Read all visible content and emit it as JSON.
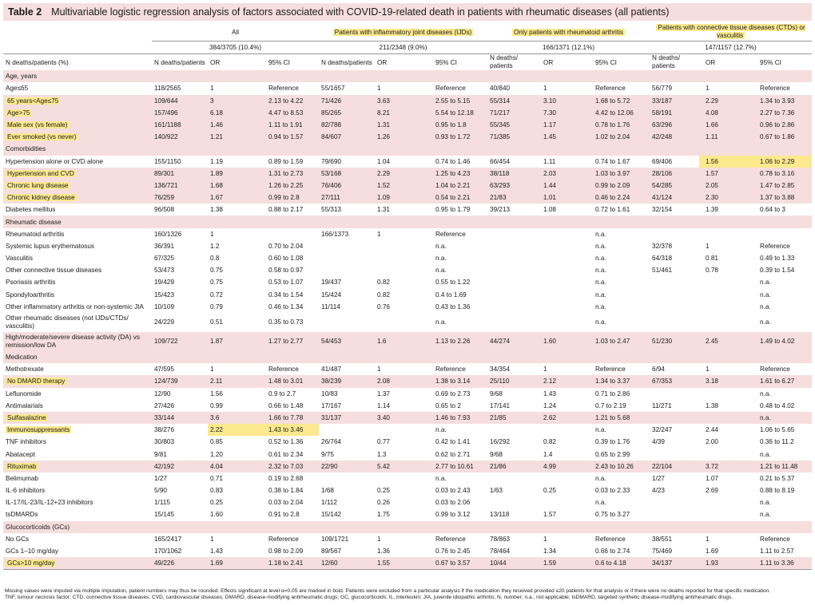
{
  "title": {
    "label": "Table 2",
    "text": "Multivariable logistic regression analysis of factors associated with COVID-19-related death in patients with rheumatic diseases (all patients)"
  },
  "groups": [
    {
      "name": "All",
      "total": "384/3705 (10.4%)",
      "highlight": false
    },
    {
      "name": "Patients with inflammatory joint diseases (IJDs)",
      "total": "211/2348 (9.0%)",
      "highlight": true
    },
    {
      "name": "Only patients with rheumatoid arthritis",
      "total": "166/1371 (12.1%)",
      "highlight": true
    },
    {
      "name": "Patients with connective tissue diseases (CTDs) or vasculitis",
      "total": "147/1157 (12.7%)",
      "highlight": true
    }
  ],
  "column_headers": {
    "first": "N deaths/patients (%)",
    "g1": [
      "N deaths/patients",
      "OR",
      "95% CI"
    ],
    "g2": [
      "N deaths/patients",
      "OR",
      "95% CI"
    ],
    "g3": [
      "N deaths/ patients",
      "OR",
      "95% CI"
    ],
    "g4": [
      "N deaths/ patients",
      "OR",
      "95% CI"
    ]
  },
  "rows": [
    {
      "type": "section",
      "label": "Age, years"
    },
    {
      "label": "Age≤65",
      "indent": true,
      "cells": [
        "118/2565",
        "1",
        "Reference",
        "55/1657",
        "1",
        "Reference",
        "40/840",
        "1",
        "Reference",
        "56/779",
        "1",
        "Reference"
      ]
    },
    {
      "label": "65 years<Age≤75",
      "indent": true,
      "pink": true,
      "hl_label": true,
      "bold": [
        1,
        2,
        4,
        5,
        7,
        8,
        10,
        11
      ],
      "hl": [
        1,
        2,
        4,
        5,
        7,
        8,
        10,
        11
      ],
      "cells": [
        "109/644",
        "3",
        "2.13 to 4.22",
        "71/426",
        "3.63",
        "2.55 to 5.15",
        "55/314",
        "3.10",
        "1.68 to 5.72",
        "33/187",
        "2.29",
        "1.34 to 3.93"
      ]
    },
    {
      "label": "Age>75",
      "indent": true,
      "pink": true,
      "hl_label": true,
      "bold": [
        1,
        2,
        4,
        5,
        7,
        8,
        10,
        11
      ],
      "hl": [
        1,
        2,
        4,
        5,
        7,
        8,
        10,
        11
      ],
      "cells": [
        "157/496",
        "6.18",
        "4.47 to 8.53",
        "85/265",
        "8.21",
        "5.54 to 12.18",
        "71/217",
        "7.30",
        "4.42 to 12.06",
        "58/191",
        "4.08",
        "2.27 to 7.36"
      ]
    },
    {
      "label": "Male sex (vs female)",
      "indent": false,
      "pink": true,
      "hl_label": true,
      "bold": [
        1,
        2
      ],
      "hl": [
        1,
        2
      ],
      "cells": [
        "161/1188",
        "1.46",
        "1.11 to 1.91",
        "82/788",
        "1.31",
        "0.95 to 1.8",
        "55/345",
        "1.17",
        "0.78 to 1.76",
        "63/296",
        "1.66",
        "0.96 to 2.86"
      ]
    },
    {
      "label": "Ever smoked (vs never)",
      "indent": false,
      "pink": true,
      "hl_label": true,
      "bold": [
        7,
        8
      ],
      "hl": [
        7,
        8
      ],
      "cells": [
        "140/922",
        "1.21",
        "0.94 to 1.57",
        "84/607",
        "1.26",
        "0.93 to 1.72",
        "71/385",
        "1.45",
        "1.02 to 2.04",
        "42/248",
        "1.11",
        "0.67 to 1.86"
      ]
    },
    {
      "type": "section",
      "label": "Comorbidities"
    },
    {
      "label": "Hypertension alone or CVD alone",
      "indent": true,
      "bold": [
        10,
        11
      ],
      "hl": [
        10,
        11
      ],
      "cells": [
        "155/1150",
        "1.19",
        "0.89 to 1.59",
        "79/690",
        "1.04",
        "0.74 to 1.46",
        "66/454",
        "1.11",
        "0.74 to 1.67",
        "69/406",
        "1.56",
        "1.06 to 2.29"
      ]
    },
    {
      "label": "Hypertension and CVD",
      "indent": true,
      "pink": true,
      "hl_label": true,
      "bold": [
        1,
        2,
        4,
        5,
        7,
        8
      ],
      "hl": [
        1,
        2,
        4,
        5,
        7,
        8
      ],
      "cells": [
        "89/301",
        "1.89",
        "1.31 to 2.73",
        "53/168",
        "2.29",
        "1.25 to 4.23",
        "38/118",
        "2.03",
        "1.03 to 3.97",
        "28/106",
        "1.57",
        "0.78 to 3.16"
      ]
    },
    {
      "label": "Chronic lung disease",
      "indent": true,
      "pink": true,
      "hl_label": true,
      "bold": [
        1,
        2,
        4,
        5,
        10,
        11
      ],
      "hl": [
        1,
        2,
        4,
        5,
        10,
        11
      ],
      "cells": [
        "136/721",
        "1.68",
        "1.26 to 2.25",
        "76/406",
        "1.52",
        "1.04 to 2.21",
        "63/293",
        "1.44",
        "0.99 to 2.09",
        "54/285",
        "2.05",
        "1.47 to 2.85"
      ]
    },
    {
      "label": "Chronic kidney disease",
      "indent": true,
      "pink": true,
      "hl_label": true,
      "bold": [
        10,
        11
      ],
      "hl": [
        10,
        11
      ],
      "cells": [
        "76/259",
        "1.67",
        "0.99 to 2.8",
        "27/111",
        "1.09",
        "0.54 to 2.21",
        "21/83",
        "1.01",
        "0.46 to 2.24",
        "41/124",
        "2.30",
        "1.37 to 3.88"
      ]
    },
    {
      "label": "Diabetes mellitus",
      "indent": true,
      "cells": [
        "96/508",
        "1.38",
        "0.88 to 2.17",
        "55/313",
        "1.31",
        "0.95 to 1.79",
        "39/213",
        "1.08",
        "0.72 to 1.61",
        "32/154",
        "1.39",
        "0.64 to 3"
      ]
    },
    {
      "type": "section",
      "label": "Rheumatic disease"
    },
    {
      "label": "Rheumatoid arthritis",
      "indent": true,
      "cells": [
        "160/1326",
        "1",
        "",
        "166/1373",
        "1",
        "Reference",
        "",
        "",
        "n.a.",
        "",
        "",
        ""
      ]
    },
    {
      "label": "Systemic lupus erythematosus",
      "indent": true,
      "cells": [
        "36/391",
        "1.2",
        "0.70 to 2.04",
        "",
        "",
        "n.a.",
        "",
        "",
        "n.a.",
        "32/378",
        "1",
        "Reference"
      ]
    },
    {
      "label": "Vasculitis",
      "indent": true,
      "cells": [
        "67/325",
        "0.8",
        "0.60 to 1.08",
        "",
        "",
        "n.a.",
        "",
        "",
        "n.a.",
        "64/318",
        "0.81",
        "0.49 to 1.33"
      ]
    },
    {
      "label": "Other connective tissue diseases",
      "indent": true,
      "bold": [
        1,
        2
      ],
      "cells": [
        "53/473",
        "0.75",
        "0.58 to 0.97",
        "",
        "",
        "n.a.",
        "",
        "",
        "n.a.",
        "51/461",
        "0.78",
        "0.39 to 1.54"
      ]
    },
    {
      "label": "Psoriasis arthritis",
      "indent": true,
      "cells": [
        "19/429",
        "0.75",
        "0.53 to 1.07",
        "19/437",
        "0.82",
        "0.55 to 1.22",
        "",
        "",
        "n.a.",
        "",
        "",
        "n.a."
      ]
    },
    {
      "label": "Spondyloarthritis",
      "indent": true,
      "cells": [
        "15/423",
        "0.72",
        "0.34 to 1.54",
        "15/424",
        "0.82",
        "0.4 to 1.69",
        "",
        "",
        "n.a.",
        "",
        "",
        "n.a."
      ]
    },
    {
      "label": "Other inflammatory arthritis or non-systemic JIA",
      "indent": true,
      "cells": [
        "10/109",
        "0.79",
        "0.46 to 1.34",
        "11/114",
        "0.76",
        "0.43 to 1.36",
        "",
        "",
        "n.a.",
        "",
        "",
        "n.a."
      ]
    },
    {
      "label": "Other rheumatic diseases (not IJDs/CTDs/ vasculitis)",
      "indent": true,
      "tall": true,
      "bold": [
        1,
        2
      ],
      "cells": [
        "24/229",
        "0.51",
        "0.35 to 0.73",
        "",
        "",
        "n.a.",
        "",
        "",
        "n.a.",
        "",
        "",
        "n.a."
      ]
    },
    {
      "label": "High/moderate/severe disease activity (DA) vs remission/low DA",
      "indent": false,
      "tall": true,
      "pink": true,
      "bold": [
        1,
        2,
        4,
        5,
        7,
        8,
        10,
        11
      ],
      "hl": [
        1,
        2,
        4,
        5,
        7,
        8,
        10,
        11
      ],
      "cells": [
        "109/722",
        "1.87",
        "1.27 to 2.77",
        "54/453",
        "1.6",
        "1.13 to 2.26",
        "44/274",
        "1.60",
        "1.03 to 2.47",
        "51/230",
        "2.45",
        "1.49 to 4.02"
      ]
    },
    {
      "type": "section",
      "label": "Medication"
    },
    {
      "label": "Methotrexate",
      "indent": true,
      "cells": [
        "47/595",
        "1",
        "Reference",
        "41/487",
        "1",
        "Reference",
        "34/354",
        "1",
        "Reference",
        "6/94",
        "1",
        "Reference"
      ]
    },
    {
      "label": "No DMARD therapy",
      "indent": true,
      "pink": true,
      "hl_label": true,
      "bold": [
        1,
        2,
        4,
        5,
        7,
        8,
        10,
        11
      ],
      "hl": [
        1,
        2,
        4,
        5,
        7,
        8,
        10,
        11
      ],
      "cells": [
        "124/739",
        "2.11",
        "1.48 to 3.01",
        "38/239",
        "2.08",
        "1.38 to 3.14",
        "25/110",
        "2.12",
        "1.34 to 3.37",
        "67/353",
        "3.18",
        "1.61 to 6.27"
      ]
    },
    {
      "label": "Leflunomide",
      "indent": true,
      "cells": [
        "12/90",
        "1.56",
        "0.9 to 2.7",
        "10/83",
        "1.37",
        "0.69 to 2.73",
        "9/68",
        "1.43",
        "0.71 to 2.86",
        "",
        "",
        "n.a."
      ]
    },
    {
      "label": "Antimalarials",
      "indent": true,
      "cells": [
        "27/426",
        "0.99",
        "0.66 to 1.48",
        "17/167",
        "1.14",
        "0.65 to 2",
        "17/141",
        "1.24",
        "0.7 to 2.19",
        "11/271",
        "1.38",
        "0.48 to 4.02"
      ]
    },
    {
      "label": "Sulfasalazine",
      "indent": true,
      "pink": true,
      "hl_label": true,
      "bold": [
        1,
        2,
        4,
        5,
        7,
        8
      ],
      "hl": [
        1,
        2,
        4,
        5,
        7,
        8
      ],
      "cells": [
        "33/144",
        "3.6",
        "1.66 to 7.78",
        "31/137",
        "3.40",
        "1.46 to 7.93",
        "21/85",
        "2.62",
        "1.21 to 5.68",
        "",
        "",
        "n.a."
      ]
    },
    {
      "label": "Immunosuppressants",
      "indent": true,
      "hl_label": true,
      "bold": [
        1,
        2,
        10,
        11
      ],
      "hl": [
        1,
        2
      ],
      "cells": [
        "38/276",
        "2.22",
        "1.43 to 3.46",
        "",
        "",
        "n.a.",
        "",
        "",
        "n.a.",
        "32/247",
        "2.44",
        "1.06 to 5.65"
      ]
    },
    {
      "label": "TNF inhibitors",
      "indent": true,
      "cells": [
        "30/803",
        "0.85",
        "0.52 to 1.36",
        "26/764",
        "0.77",
        "0.42 to 1.41",
        "16/292",
        "0.82",
        "0.39 to 1.76",
        "4/39",
        "2.00",
        "0.36 to 11.2"
      ]
    },
    {
      "label": "Abatacept",
      "indent": true,
      "cells": [
        "9/81",
        "1.20",
        "0.61 to 2.34",
        "9/75",
        "1.3",
        "0.62 to 2.71",
        "9/68",
        "1.4",
        "0.65 to 2.99",
        "",
        "",
        "n.a."
      ]
    },
    {
      "label": "Rituximab",
      "indent": true,
      "pink": true,
      "hl_label": true,
      "bold": [
        1,
        2,
        4,
        5,
        7,
        8,
        10,
        11
      ],
      "hl": [
        1,
        2,
        4,
        5,
        7,
        8,
        10,
        11
      ],
      "cells": [
        "42/192",
        "4.04",
        "2.32 to 7.03",
        "22/90",
        "5.42",
        "2.77 to 10.61",
        "21/86",
        "4.99",
        "2.43 to 10.26",
        "22/104",
        "3.72",
        "1.21 to 11.48"
      ]
    },
    {
      "label": "Belimumab",
      "indent": true,
      "cells": [
        "1/27",
        "0.71",
        "0.19 to 2.68",
        "",
        "",
        "n.a.",
        "",
        "",
        "n.a.",
        "1/27",
        "1.07",
        "0.21 to 5.37"
      ]
    },
    {
      "label": "IL-6 inhibitors",
      "indent": true,
      "cells": [
        "5/90",
        "0.83",
        "0.38 to 1.84",
        "1/68",
        "0.25",
        "0.03 to 2.43",
        "1/63",
        "0.25",
        "0.03 to 2.33",
        "4/23",
        "2.69",
        "0.88 to 8.19"
      ]
    },
    {
      "label": "IL-17/IL-23/IL-12+23 inhibitors",
      "indent": true,
      "cells": [
        "1/115",
        "0.25",
        "0.03 to 2.04",
        "1/112",
        "0.26",
        "0.03 to 2.06",
        "",
        "",
        "n.a.",
        "",
        "",
        "n.a."
      ]
    },
    {
      "label": "tsDMARDs",
      "indent": true,
      "cells": [
        "15/145",
        "1.60",
        "0.91 to 2.8",
        "15/142",
        "1.75",
        "0.99 to 3.12",
        "13/118",
        "1.57",
        "0.75 to 3.27",
        "",
        "",
        "n.a."
      ]
    },
    {
      "type": "section",
      "label": "Glucocorticoids (GCs)"
    },
    {
      "label": "No GCs",
      "indent": true,
      "cells": [
        "165/2417",
        "1",
        "Reference",
        "109/1721",
        "1",
        "Reference",
        "78/863",
        "1",
        "Reference",
        "38/551",
        "1",
        "Reference"
      ]
    },
    {
      "label": "GCs 1–10 mg/day",
      "indent": true,
      "bold": [
        10,
        11
      ],
      "cells": [
        "170/1062",
        "1.43",
        "0.98 to 2.09",
        "89/567",
        "1.36",
        "0.76 to 2.45",
        "78/464",
        "1.34",
        "0.66 to 2.74",
        "75/469",
        "1.69",
        "1.11 to 2.57"
      ]
    },
    {
      "label": "GCs>10 mg/day",
      "indent": true,
      "pink": true,
      "hl_label": true,
      "last": true,
      "bold": [
        1,
        2,
        10,
        11
      ],
      "hl": [
        1,
        2,
        10,
        11
      ],
      "cells": [
        "49/226",
        "1.69",
        "1.18 to 2.41",
        "12/60",
        "1.55",
        "0.67 to 3.57",
        "10/44",
        "1.59",
        "0.6 to 4.18",
        "34/137",
        "1.93",
        "1.11 to 3.36"
      ]
    }
  ],
  "footnotes": [
    "Missing values were imputed via multiple imputation, patient numbers may thus be rounded. Effects significant at level α=0.05 are marked in bold. Patients were excluded from a particular analysis if the medication they received provided ≤20 patients for that analysis or if there were no deaths reported for that specific medication.",
    "TNF, tumour necrosis factor; CTD, connective tissue diseases; CVD, cardiovascular diseases; DMARD, disease-modifying antirheumatic drugs; GC, glucocorticoids; IL, interleukin; JIA, juvenile idiopathic arthritis; N, number; n.a., not applicable; tsDMARD, targeted synthetic disease-modifying antirheumatic drugs."
  ],
  "colors": {
    "section_bg": "#f6dede",
    "highlight": "#fce98e"
  }
}
